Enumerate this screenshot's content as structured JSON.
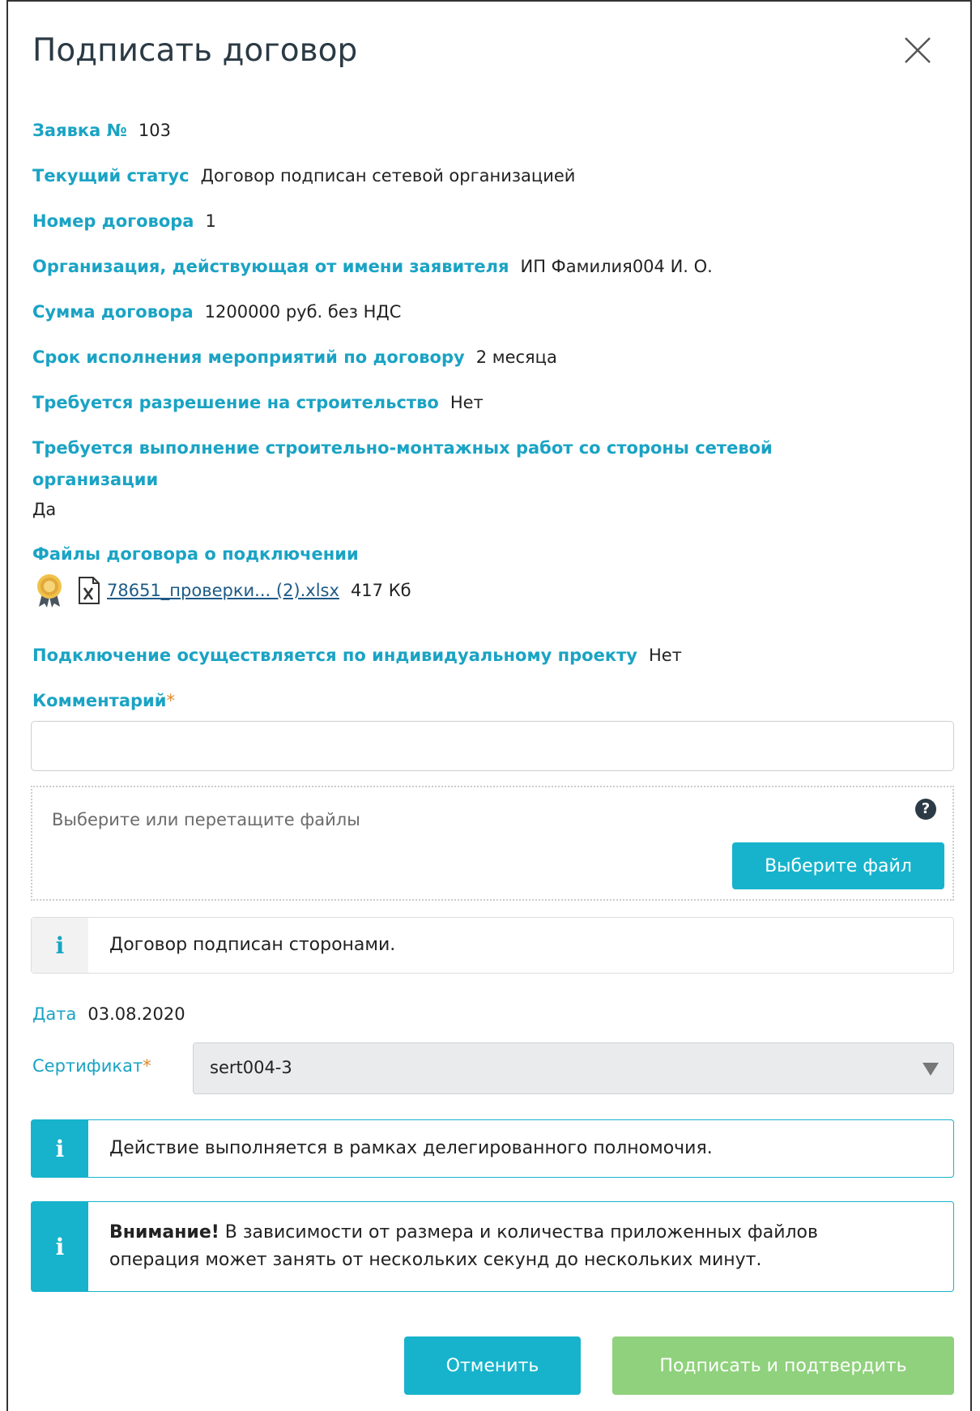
{
  "dialog": {
    "title": "Подписать договор",
    "close_label": "×"
  },
  "fields": {
    "application_label": "Заявка №",
    "application_value": "103",
    "status_label": "Текущий статус",
    "status_value": "Договор подписан сетевой организацией",
    "contract_no_label": "Номер договора",
    "contract_no_value": "1",
    "org_label": "Организация, действующая от имени заявителя",
    "org_value": "ИП Фамилия004 И. О.",
    "sum_label": "Сумма договора",
    "sum_value": "1200000 руб. без НДС",
    "term_label": "Срок исполнения мероприятий по договору",
    "term_value": "2 месяца",
    "permit_label": "Требуется разрешение на строительство",
    "permit_value": "Нет",
    "works_label_line1": "Требуется выполнение строительно-монтажных работ со стороны сетевой",
    "works_label_line2": "организации",
    "works_value": "Да",
    "files_label": "Файлы договора о подключении",
    "individual_label": "Подключение осуществляется по индивидуальному проекту",
    "individual_value": "Нет"
  },
  "file": {
    "name": "78651_проверки... (2).xlsx",
    "size": "417 Кб"
  },
  "comment": {
    "label": "Комментарий",
    "required_mark": "*",
    "value": ""
  },
  "dropzone": {
    "text": "Выберите или перетащите файлы",
    "help_icon": "?",
    "button_label": "Выберите файл"
  },
  "notices": {
    "signed": "Договор подписан сторонами.",
    "delegated": "Действие выполняется в рамках делегированного полномочия.",
    "warning_bold": "Внимание!",
    "warning_line1": " В зависимости от размера и количества приложенных файлов",
    "warning_line2": "операция может занять от нескольких секунд до нескольких минут.",
    "info_icon": "i"
  },
  "date": {
    "label": "Дата",
    "value": "03.08.2020"
  },
  "certificate": {
    "label": "Сертификат",
    "required_mark": "*",
    "value": "sert004-3"
  },
  "actions": {
    "cancel_label": "Отменить",
    "sign_label": "Подписать и подтвердить"
  },
  "colors": {
    "label": "#1aa3c4",
    "teal_button": "#17b3cc",
    "green_button": "#8fd17c",
    "required": "#e08a28"
  },
  "icons": {
    "certificate_badge": "certificate-badge-icon",
    "excel_file": "excel-file-icon",
    "close": "close-icon",
    "help": "help-icon",
    "info": "info-icon",
    "dropdown": "chevron-down-icon"
  }
}
